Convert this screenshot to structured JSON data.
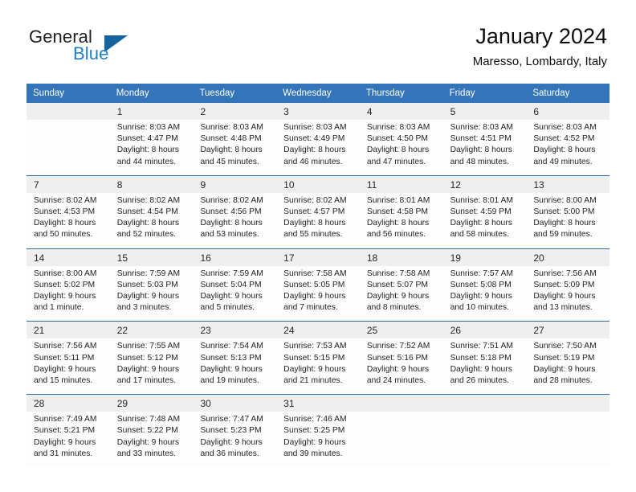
{
  "brand": {
    "name_part1": "General",
    "name_part2": "Blue",
    "triangle_color": "#14659e",
    "blue_color": "#1f7fc4"
  },
  "header": {
    "title": "January 2024",
    "subtitle": "Maresso, Lombardy, Italy"
  },
  "theme": {
    "header_blue": "#3375b8",
    "separator_blue": "#2e6da4",
    "daynum_band": "#efefef",
    "cell_background": "#fdfdfd"
  },
  "weekdays": [
    "Sunday",
    "Monday",
    "Tuesday",
    "Wednesday",
    "Thursday",
    "Friday",
    "Saturday"
  ],
  "weeks": [
    [
      {
        "day": "",
        "lines": []
      },
      {
        "day": "1",
        "lines": [
          "Sunrise: 8:03 AM",
          "Sunset: 4:47 PM",
          "Daylight: 8 hours",
          "and 44 minutes."
        ]
      },
      {
        "day": "2",
        "lines": [
          "Sunrise: 8:03 AM",
          "Sunset: 4:48 PM",
          "Daylight: 8 hours",
          "and 45 minutes."
        ]
      },
      {
        "day": "3",
        "lines": [
          "Sunrise: 8:03 AM",
          "Sunset: 4:49 PM",
          "Daylight: 8 hours",
          "and 46 minutes."
        ]
      },
      {
        "day": "4",
        "lines": [
          "Sunrise: 8:03 AM",
          "Sunset: 4:50 PM",
          "Daylight: 8 hours",
          "and 47 minutes."
        ]
      },
      {
        "day": "5",
        "lines": [
          "Sunrise: 8:03 AM",
          "Sunset: 4:51 PM",
          "Daylight: 8 hours",
          "and 48 minutes."
        ]
      },
      {
        "day": "6",
        "lines": [
          "Sunrise: 8:03 AM",
          "Sunset: 4:52 PM",
          "Daylight: 8 hours",
          "and 49 minutes."
        ]
      }
    ],
    [
      {
        "day": "7",
        "lines": [
          "Sunrise: 8:02 AM",
          "Sunset: 4:53 PM",
          "Daylight: 8 hours",
          "and 50 minutes."
        ]
      },
      {
        "day": "8",
        "lines": [
          "Sunrise: 8:02 AM",
          "Sunset: 4:54 PM",
          "Daylight: 8 hours",
          "and 52 minutes."
        ]
      },
      {
        "day": "9",
        "lines": [
          "Sunrise: 8:02 AM",
          "Sunset: 4:56 PM",
          "Daylight: 8 hours",
          "and 53 minutes."
        ]
      },
      {
        "day": "10",
        "lines": [
          "Sunrise: 8:02 AM",
          "Sunset: 4:57 PM",
          "Daylight: 8 hours",
          "and 55 minutes."
        ]
      },
      {
        "day": "11",
        "lines": [
          "Sunrise: 8:01 AM",
          "Sunset: 4:58 PM",
          "Daylight: 8 hours",
          "and 56 minutes."
        ]
      },
      {
        "day": "12",
        "lines": [
          "Sunrise: 8:01 AM",
          "Sunset: 4:59 PM",
          "Daylight: 8 hours",
          "and 58 minutes."
        ]
      },
      {
        "day": "13",
        "lines": [
          "Sunrise: 8:00 AM",
          "Sunset: 5:00 PM",
          "Daylight: 8 hours",
          "and 59 minutes."
        ]
      }
    ],
    [
      {
        "day": "14",
        "lines": [
          "Sunrise: 8:00 AM",
          "Sunset: 5:02 PM",
          "Daylight: 9 hours",
          "and 1 minute."
        ]
      },
      {
        "day": "15",
        "lines": [
          "Sunrise: 7:59 AM",
          "Sunset: 5:03 PM",
          "Daylight: 9 hours",
          "and 3 minutes."
        ]
      },
      {
        "day": "16",
        "lines": [
          "Sunrise: 7:59 AM",
          "Sunset: 5:04 PM",
          "Daylight: 9 hours",
          "and 5 minutes."
        ]
      },
      {
        "day": "17",
        "lines": [
          "Sunrise: 7:58 AM",
          "Sunset: 5:05 PM",
          "Daylight: 9 hours",
          "and 7 minutes."
        ]
      },
      {
        "day": "18",
        "lines": [
          "Sunrise: 7:58 AM",
          "Sunset: 5:07 PM",
          "Daylight: 9 hours",
          "and 8 minutes."
        ]
      },
      {
        "day": "19",
        "lines": [
          "Sunrise: 7:57 AM",
          "Sunset: 5:08 PM",
          "Daylight: 9 hours",
          "and 10 minutes."
        ]
      },
      {
        "day": "20",
        "lines": [
          "Sunrise: 7:56 AM",
          "Sunset: 5:09 PM",
          "Daylight: 9 hours",
          "and 13 minutes."
        ]
      }
    ],
    [
      {
        "day": "21",
        "lines": [
          "Sunrise: 7:56 AM",
          "Sunset: 5:11 PM",
          "Daylight: 9 hours",
          "and 15 minutes."
        ]
      },
      {
        "day": "22",
        "lines": [
          "Sunrise: 7:55 AM",
          "Sunset: 5:12 PM",
          "Daylight: 9 hours",
          "and 17 minutes."
        ]
      },
      {
        "day": "23",
        "lines": [
          "Sunrise: 7:54 AM",
          "Sunset: 5:13 PM",
          "Daylight: 9 hours",
          "and 19 minutes."
        ]
      },
      {
        "day": "24",
        "lines": [
          "Sunrise: 7:53 AM",
          "Sunset: 5:15 PM",
          "Daylight: 9 hours",
          "and 21 minutes."
        ]
      },
      {
        "day": "25",
        "lines": [
          "Sunrise: 7:52 AM",
          "Sunset: 5:16 PM",
          "Daylight: 9 hours",
          "and 24 minutes."
        ]
      },
      {
        "day": "26",
        "lines": [
          "Sunrise: 7:51 AM",
          "Sunset: 5:18 PM",
          "Daylight: 9 hours",
          "and 26 minutes."
        ]
      },
      {
        "day": "27",
        "lines": [
          "Sunrise: 7:50 AM",
          "Sunset: 5:19 PM",
          "Daylight: 9 hours",
          "and 28 minutes."
        ]
      }
    ],
    [
      {
        "day": "28",
        "lines": [
          "Sunrise: 7:49 AM",
          "Sunset: 5:21 PM",
          "Daylight: 9 hours",
          "and 31 minutes."
        ]
      },
      {
        "day": "29",
        "lines": [
          "Sunrise: 7:48 AM",
          "Sunset: 5:22 PM",
          "Daylight: 9 hours",
          "and 33 minutes."
        ]
      },
      {
        "day": "30",
        "lines": [
          "Sunrise: 7:47 AM",
          "Sunset: 5:23 PM",
          "Daylight: 9 hours",
          "and 36 minutes."
        ]
      },
      {
        "day": "31",
        "lines": [
          "Sunrise: 7:46 AM",
          "Sunset: 5:25 PM",
          "Daylight: 9 hours",
          "and 39 minutes."
        ]
      },
      {
        "day": "",
        "lines": []
      },
      {
        "day": "",
        "lines": []
      },
      {
        "day": "",
        "lines": []
      }
    ]
  ]
}
